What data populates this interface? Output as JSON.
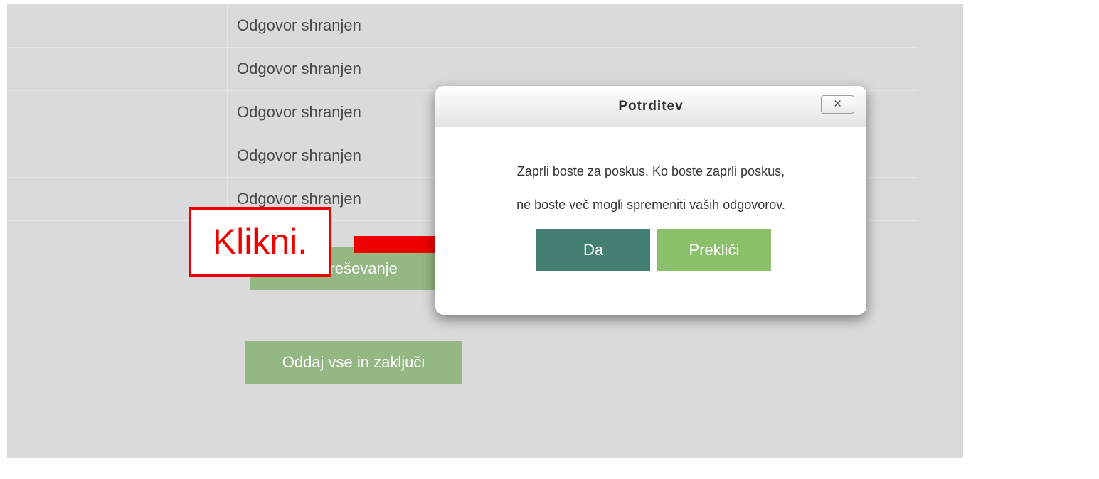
{
  "summary": {
    "rows": [
      {
        "status": "Odgovor shranjen"
      },
      {
        "status": "Odgovor shranjen"
      },
      {
        "status": "Odgovor shranjen"
      },
      {
        "status": "Odgovor shranjen"
      },
      {
        "status": "Odgovor shranjen"
      }
    ]
  },
  "buttons": {
    "return_visible": "a reševanje",
    "submit": "Oddaj vse in zaključi"
  },
  "annotation": {
    "label": "Klikni."
  },
  "dialog": {
    "title": "Potrditev",
    "close_icon": "×",
    "message_line1": "Zaprli boste za poskus. Ko boste zaprli poskus,",
    "message_line2": "ne boste več mogli spremeniti vaših odgovorov.",
    "confirm": "Da",
    "cancel": "Prekliči"
  },
  "colors": {
    "page_background": "#dadada",
    "faded_button": "#93b883",
    "confirm_button": "#447f73",
    "cancel_button": "#8ac06a",
    "annotation_red": "#ee0000"
  },
  "icons": {
    "close": "close-icon",
    "arrow": "red-arrow-icon"
  }
}
